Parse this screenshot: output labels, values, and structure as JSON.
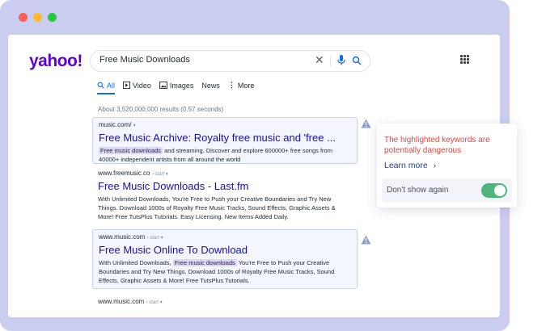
{
  "search": {
    "logo": "yahoo!",
    "query": "Free Music Downloads"
  },
  "tabs": [
    {
      "label": "All",
      "icon": "search-icon"
    },
    {
      "label": "Video",
      "icon": "play-icon"
    },
    {
      "label": "Images",
      "icon": "image-icon"
    },
    {
      "label": "News"
    },
    {
      "label": "More",
      "icon": "more-vertical-icon"
    }
  ],
  "results_count": "About 3,520,000,000 results (0.57 seconds)",
  "results": [
    {
      "url": "music.com/",
      "url_suffix": "▾",
      "title": "Free Music Archive: Royalty free music and 'free ...",
      "keyword": "Free music downloads",
      "desc_after": " and streaming. Discover and explore 600000+ free songs from 40000+ independent artists from all around the world"
    },
    {
      "url": "www.freemusic.co",
      "url_suffix": "› start ▾",
      "title": "Free Music Downloads - Last.fm",
      "desc": "With Unlimited Downloads, You're Free to Push your Creative Boundaries and Try New Things. Download 1000s of Royalty Free Music Tracks, Sound Effects, Graphic Assets & More! Free TutsPlus Tutorials. Easy Licensing. New Items Added Daily."
    },
    {
      "url": "www.music.com",
      "url_suffix": "› start ▾",
      "title": "Free Music Online To Download",
      "desc_before": "With Unlimited Downloads, ",
      "keyword": "Free music downloads",
      "desc_after": " You're Free to Push your Creative Boundaries and Try New Things. Download 1000s of Royalty Free Music Tracks, Sound Effects, Graphic Assets & More! Free TutsPlus Tutorials."
    },
    {
      "url": "www.music.com",
      "url_suffix": "› start ▾"
    }
  ],
  "popup": {
    "message": "The highlighted keywords are potentially dangerous",
    "link": "Learn more",
    "link_arrow": "›",
    "toggle_label": "Don't show again",
    "toggle_on": true
  },
  "colors": {
    "brand": "#5f01d1",
    "link": "#1a0dab",
    "warning": "#e0453e",
    "toggle": "#4fb57a",
    "keyword_highlight": "#dcd6f7"
  }
}
